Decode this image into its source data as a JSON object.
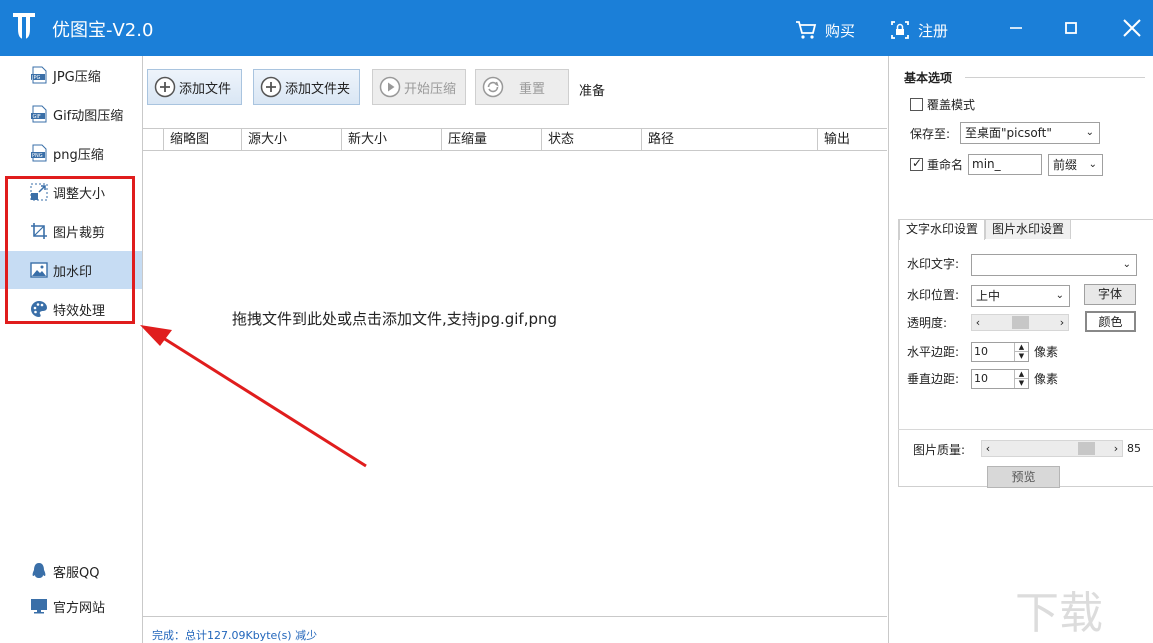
{
  "app": {
    "title": "优图宝-V2.0"
  },
  "titlebar": {
    "buy_label": "购买",
    "register_label": "注册"
  },
  "sidebar": {
    "items": [
      {
        "label": "JPG压缩",
        "icon": "jpg-file-icon"
      },
      {
        "label": "Gif动图压缩",
        "icon": "gif-file-icon"
      },
      {
        "label": "png压缩",
        "icon": "png-file-icon"
      },
      {
        "label": "调整大小",
        "icon": "resize-icon"
      },
      {
        "label": "图片裁剪",
        "icon": "crop-icon"
      },
      {
        "label": "加水印",
        "icon": "image-icon",
        "active": true
      },
      {
        "label": "特效处理",
        "icon": "palette-icon"
      }
    ],
    "bottom": [
      {
        "label": "客服QQ",
        "icon": "qq-penguin-icon"
      },
      {
        "label": "官方网站",
        "icon": "monitor-icon"
      }
    ]
  },
  "toolbar": {
    "add_file": "添加文件",
    "add_folder": "添加文件夹",
    "start": "开始压缩",
    "reset": "重置",
    "status": "准备"
  },
  "table": {
    "columns": [
      "缩略图",
      "源大小",
      "新大小",
      "压缩量",
      "状态",
      "路径",
      "输出"
    ]
  },
  "drop_hint": "拖拽文件到此处或点击添加文件,支持jpg.gif,png",
  "statusbar": {
    "text": "完成：总计127.09Kbyte(s) 减少"
  },
  "basic": {
    "title": "基本选项",
    "overwrite_label": "覆盖模式",
    "overwrite_checked": false,
    "save_to_label": "保存至:",
    "save_to_value": "至桌面\"picsoft\"",
    "rename_label": "重命名",
    "rename_checked": true,
    "rename_value": "min_",
    "rename_pos": "前缀"
  },
  "watermark": {
    "tab_text": "文字水印设置",
    "tab_image": "图片水印设置",
    "text_label": "水印文字:",
    "text_value": "",
    "position_label": "水印位置:",
    "position_value": "上中",
    "font_button": "字体",
    "opacity_label": "透明度:",
    "opacity_level": 0.5,
    "color_button": "颜色",
    "h_margin_label": "水平边距:",
    "h_margin_value": "10",
    "v_margin_label": "垂直边距:",
    "v_margin_value": "10",
    "unit": "像素"
  },
  "quality": {
    "label": "图片质量:",
    "value": "85",
    "level": 0.85
  },
  "preview_button": "预览",
  "colors": {
    "titlebar": "#1b7fd8",
    "highlight": "#e01d1d",
    "active_item": "#c6dcf3"
  }
}
